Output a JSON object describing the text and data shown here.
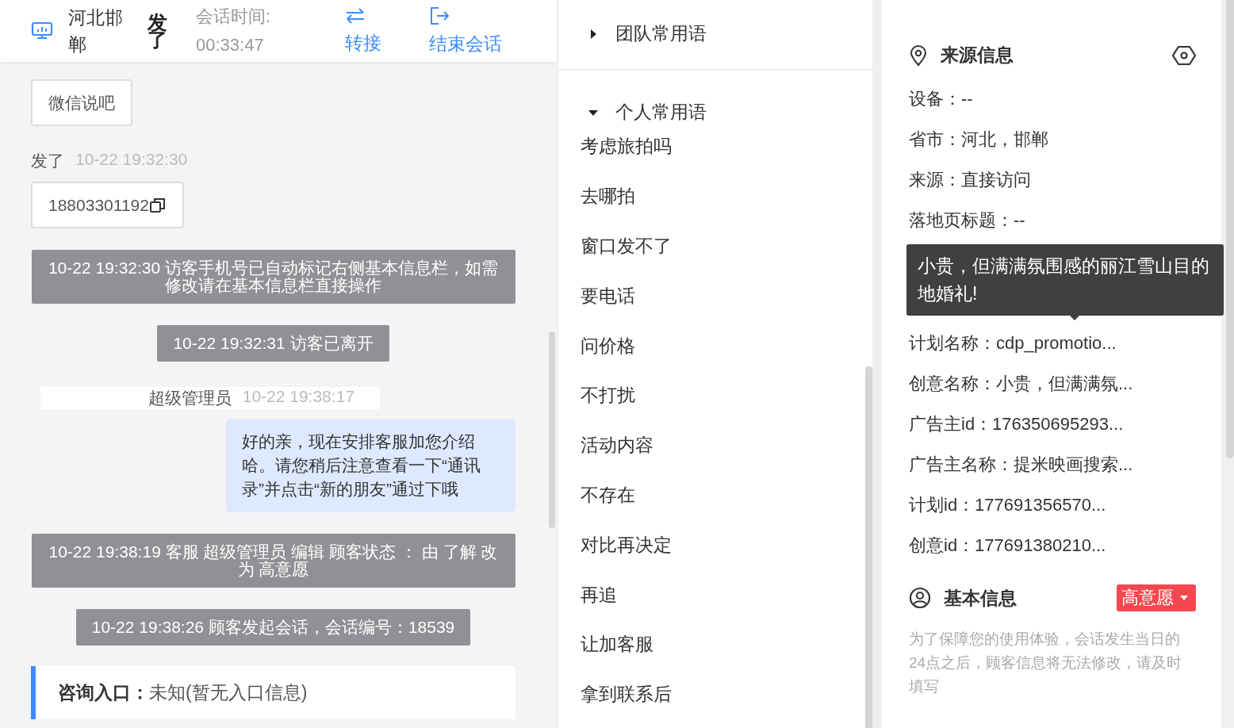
{
  "header": {
    "location": "河北邯郸",
    "visitor": "发了",
    "timer_label": "会话时间:",
    "timer": "00:33:47",
    "actions": [
      {
        "kind": "transfer",
        "label": "转接"
      },
      {
        "kind": "end",
        "label": "结束会话"
      }
    ]
  },
  "chat": [
    {
      "kind": "visitor_bubble",
      "text": "微信说吧"
    },
    {
      "kind": "visitor",
      "name": "发了",
      "time": "10-22 19:32:30",
      "text": "18803301192",
      "copyable": true
    },
    {
      "kind": "system",
      "text": "10-22 19:32:30 访客手机号已自动标记右侧基本信息栏，如需修改请在基本信息栏直接操作"
    },
    {
      "kind": "system",
      "text": "10-22 19:32:31 访客已离开"
    },
    {
      "kind": "agent",
      "name": "超级管理员",
      "time": "10-22 19:38:17",
      "text": "好的亲，现在安排客服加您介绍哈。请您稍后注意查看一下“通讯录”并点击“新的朋友”通过下哦"
    },
    {
      "kind": "system",
      "text": "10-22 19:38:19 客服 超级管理员 编辑 顾客状态 ： 由 了解 改为 高意愿"
    },
    {
      "kind": "system",
      "text": "10-22 19:38:26 顾客发起会话，会话编号：18539"
    },
    {
      "kind": "info",
      "text": "**咨询入口：**未知(暂无入口信息)"
    }
  ],
  "phrases": [
    {
      "title": "团队常用语",
      "expanded": false
    },
    {
      "title": "个人常用语",
      "expanded": true,
      "items": [
        "考虑旅拍吗",
        "去哪拍",
        "窗口发不了",
        "要电话",
        "问价格",
        "不打扰",
        "活动内容",
        "不存在",
        "对比再决定",
        "再追",
        "让加客服",
        "拿到联系后"
      ]
    }
  ],
  "source_info": {
    "title": "来源信息",
    "rows": [
      "设备：--",
      "省市：河北，邯郸",
      "来源：直接访问",
      "落地页标题：--",
      "计划名称：cdp_promotio...",
      "创意名称：小贵，但满满氛...",
      "广告主id：176350695293...",
      "广告主名称：提米映画搜索...",
      "计划id：177691356570...",
      "创意id：177691380210..."
    ],
    "tooltip": "小贵，但满满氛围感的丽江雪山目的地婚礼!"
  },
  "basic_info": {
    "title": "基本信息",
    "status": "高意愿",
    "note": "为了保障您的使用体验，会话发生当日的24点之后，顾客信息将无法修改，请及时填写"
  }
}
